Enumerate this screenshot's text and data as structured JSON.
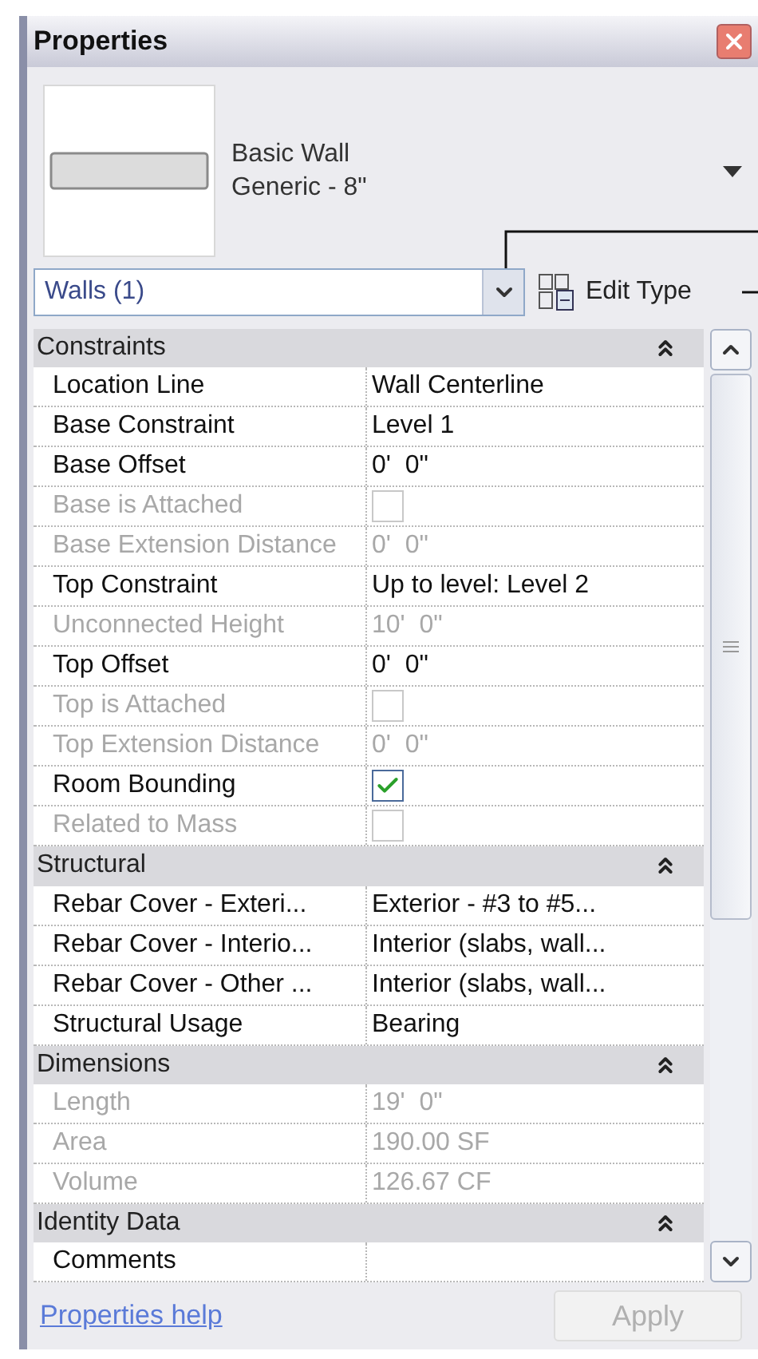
{
  "window": {
    "title": "Properties"
  },
  "type_selector": {
    "family": "Basic Wall",
    "type": "Generic - 8\""
  },
  "filter": {
    "value": "Walls (1)"
  },
  "edit_type": {
    "label": "Edit Type"
  },
  "sections": [
    {
      "title": "Constraints",
      "expanded": true,
      "rows": [
        {
          "label": "Location Line",
          "kind": "text",
          "value": "Wall Centerline",
          "disabled": false
        },
        {
          "label": "Base Constraint",
          "kind": "text",
          "value": "Level 1",
          "disabled": false
        },
        {
          "label": "Base Offset",
          "kind": "text",
          "value": "0'  0\"",
          "disabled": false
        },
        {
          "label": "Base is Attached",
          "kind": "checkbox",
          "checked": false,
          "disabled": true
        },
        {
          "label": "Base Extension Distance",
          "kind": "text",
          "value": "0'  0\"",
          "disabled": true
        },
        {
          "label": "Top Constraint",
          "kind": "text",
          "value": "Up to level: Level 2",
          "disabled": false
        },
        {
          "label": "Unconnected Height",
          "kind": "text",
          "value": "10'  0\"",
          "disabled": true
        },
        {
          "label": "Top Offset",
          "kind": "text",
          "value": "0'  0\"",
          "disabled": false
        },
        {
          "label": "Top is Attached",
          "kind": "checkbox",
          "checked": false,
          "disabled": true
        },
        {
          "label": "Top Extension Distance",
          "kind": "text",
          "value": "0'  0\"",
          "disabled": true
        },
        {
          "label": "Room Bounding",
          "kind": "checkbox",
          "checked": true,
          "disabled": false
        },
        {
          "label": "Related to Mass",
          "kind": "checkbox",
          "checked": false,
          "disabled": true
        }
      ]
    },
    {
      "title": "Structural",
      "expanded": true,
      "rows": [
        {
          "label": "Rebar Cover - Exteri...",
          "kind": "text",
          "value": "Exterior - #3 to #5...",
          "disabled": false
        },
        {
          "label": "Rebar Cover - Interio...",
          "kind": "text",
          "value": "Interior (slabs, wall...",
          "disabled": false
        },
        {
          "label": "Rebar Cover - Other ...",
          "kind": "text",
          "value": "Interior (slabs, wall...",
          "disabled": false
        },
        {
          "label": "Structural Usage",
          "kind": "text",
          "value": "Bearing",
          "disabled": false
        }
      ]
    },
    {
      "title": "Dimensions",
      "expanded": true,
      "rows": [
        {
          "label": "Length",
          "kind": "text",
          "value": "19'  0\"",
          "disabled": true
        },
        {
          "label": "Area",
          "kind": "text",
          "value": "190.00 SF",
          "disabled": true
        },
        {
          "label": "Volume",
          "kind": "text",
          "value": "126.67 CF",
          "disabled": true
        }
      ]
    },
    {
      "title": "Identity Data",
      "expanded": true,
      "rows": [
        {
          "label": "Comments",
          "kind": "text",
          "value": "",
          "disabled": false
        }
      ]
    }
  ],
  "footer": {
    "help_link": "Properties help",
    "apply": {
      "label": "Apply",
      "disabled": true
    }
  }
}
